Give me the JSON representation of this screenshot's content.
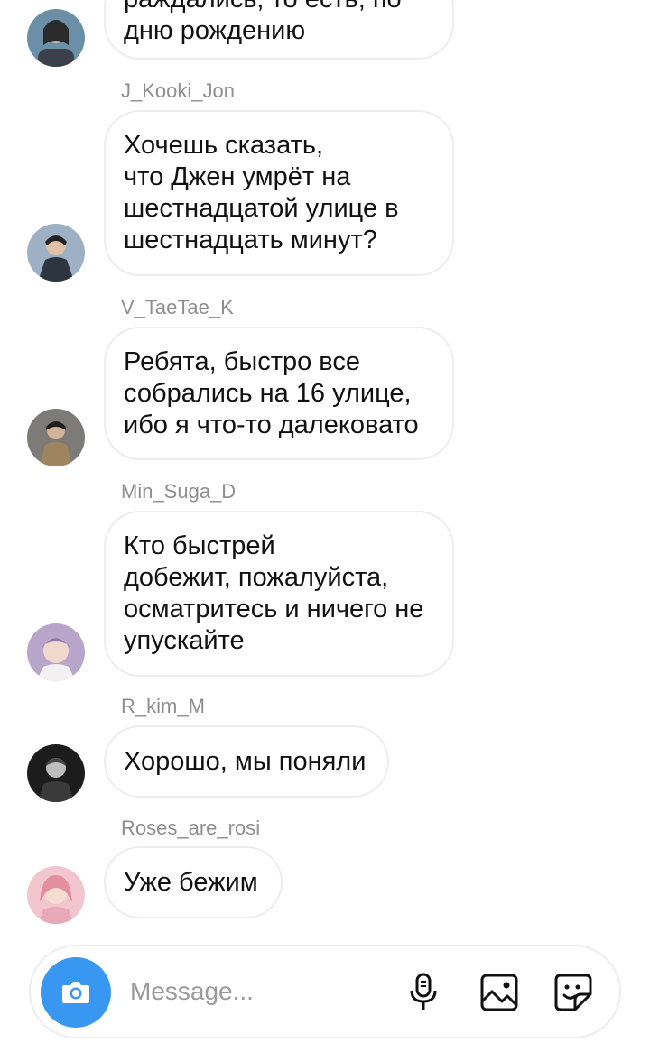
{
  "messages": [
    {
      "sender": "",
      "lines": [
        "раждались, то есть, по",
        "дню рождению"
      ]
    },
    {
      "sender": "J_Kooki_Jon",
      "lines": [
        "Хочешь сказать,",
        "что Джен умрёт на",
        "шестнадцатой улице в",
        "шестнадцать минут?"
      ]
    },
    {
      "sender": "V_TaeTae_K",
      "lines": [
        "Ребята, быстро все",
        "собрались на 16 улице,",
        "ибо я что-то далековато"
      ]
    },
    {
      "sender": "Min_Suga_D",
      "lines": [
        "Кто быстрей",
        "добежит, пожалуйста,",
        "осматритесь и ничего не",
        "упускайте"
      ]
    },
    {
      "sender": "R_kim_M",
      "lines": [
        "Хорошо, мы поняли"
      ]
    },
    {
      "sender": "Roses_are_rosi",
      "lines": [
        "Уже бежим"
      ]
    }
  ],
  "composer": {
    "placeholder": "Message...",
    "icons": [
      "camera-icon",
      "microphone-icon",
      "gallery-icon",
      "sticker-icon"
    ],
    "accent": "#3897f0"
  }
}
